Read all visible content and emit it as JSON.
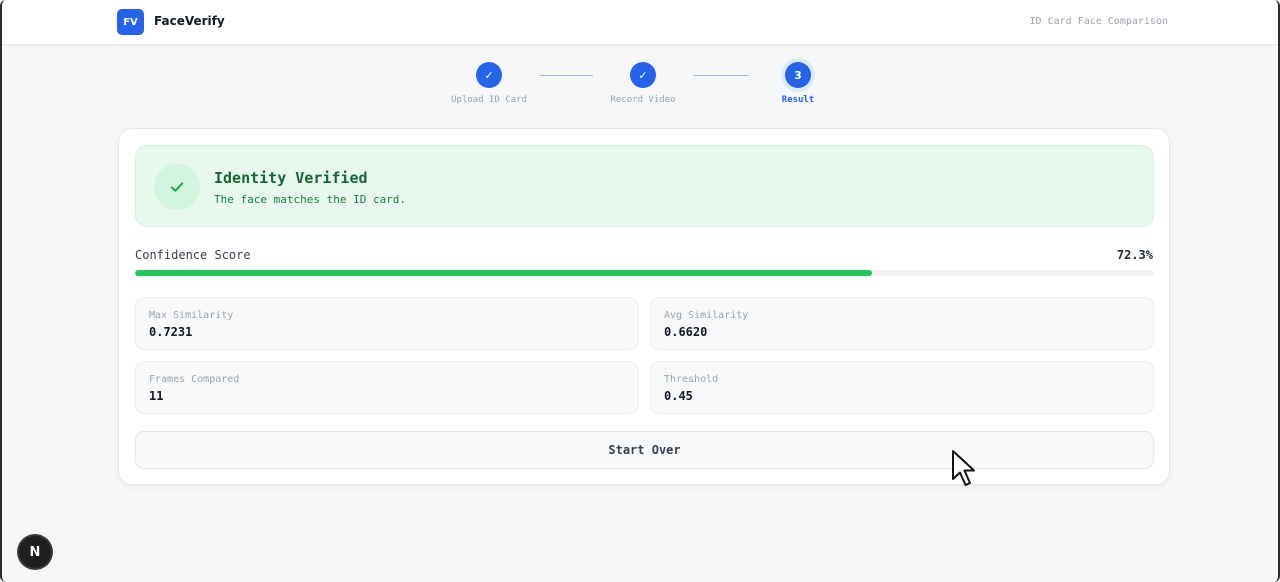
{
  "header": {
    "logo_text": "FV",
    "app_name": "FaceVerify",
    "subtitle": "ID Card Face Comparison"
  },
  "stepper": {
    "steps": [
      {
        "label": "Upload ID Card",
        "marker": "✓",
        "state": "complete"
      },
      {
        "label": "Record Video",
        "marker": "✓",
        "state": "complete"
      },
      {
        "label": "Result",
        "marker": "3",
        "state": "active"
      }
    ]
  },
  "result": {
    "title": "Identity Verified",
    "message": "The face matches the ID card.",
    "icon": "check-icon"
  },
  "confidence": {
    "label": "Confidence Score",
    "value_text": "72.3%",
    "percent": 72.3
  },
  "metrics": [
    {
      "label": "Max Similarity",
      "value": "0.7231"
    },
    {
      "label": "Avg Similarity",
      "value": "0.6620"
    },
    {
      "label": "Frames Compared",
      "value": "11"
    },
    {
      "label": "Threshold",
      "value": "0.45"
    }
  ],
  "actions": {
    "start_over_label": "Start Over"
  },
  "dev_badge": {
    "text": "N"
  },
  "colors": {
    "primary": "#2563eb",
    "success": "#22c55e",
    "success_bg": "#e8f8ee",
    "success_text": "#166534"
  }
}
